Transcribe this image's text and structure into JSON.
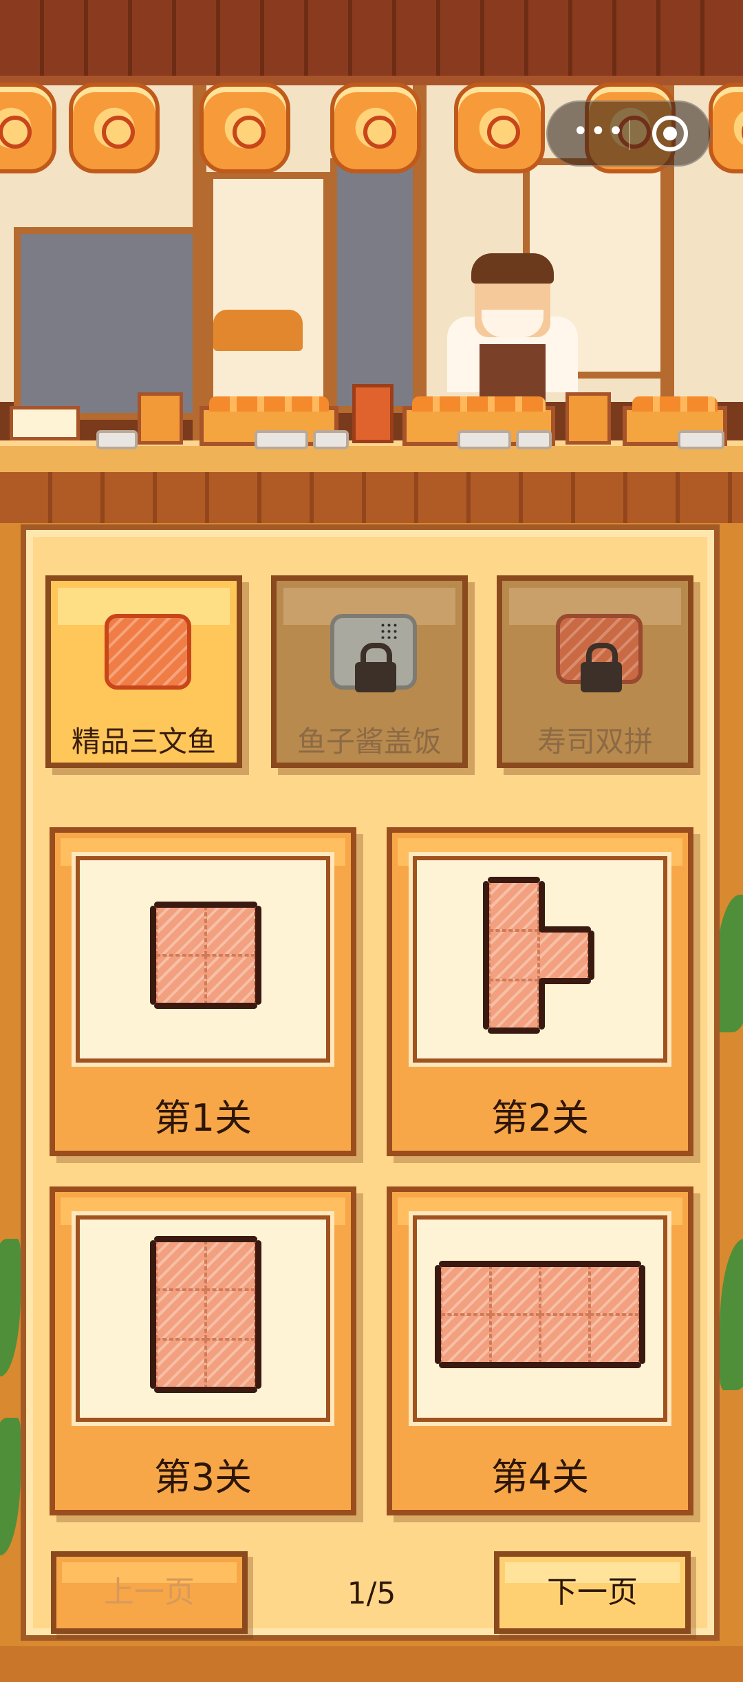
{
  "categories": [
    {
      "label": "精品三文鱼",
      "state": "active"
    },
    {
      "label": "鱼子酱盖饭",
      "state": "locked"
    },
    {
      "label": "寿司双拼",
      "state": "locked"
    }
  ],
  "levels": [
    {
      "title": "第1关"
    },
    {
      "title": "第2关"
    },
    {
      "title": "第3关"
    },
    {
      "title": "第4关"
    }
  ],
  "pagination": {
    "prev_label": "上一页",
    "next_label": "下一页",
    "indicator": "1/5"
  },
  "capsule": {
    "more_icon": "more-dots-icon",
    "close_icon": "target-close-icon"
  },
  "colors": {
    "panel": "#ffd78b",
    "card": "#f7a748",
    "border": "#9a4d1d",
    "salmon": "#f2a07f"
  }
}
